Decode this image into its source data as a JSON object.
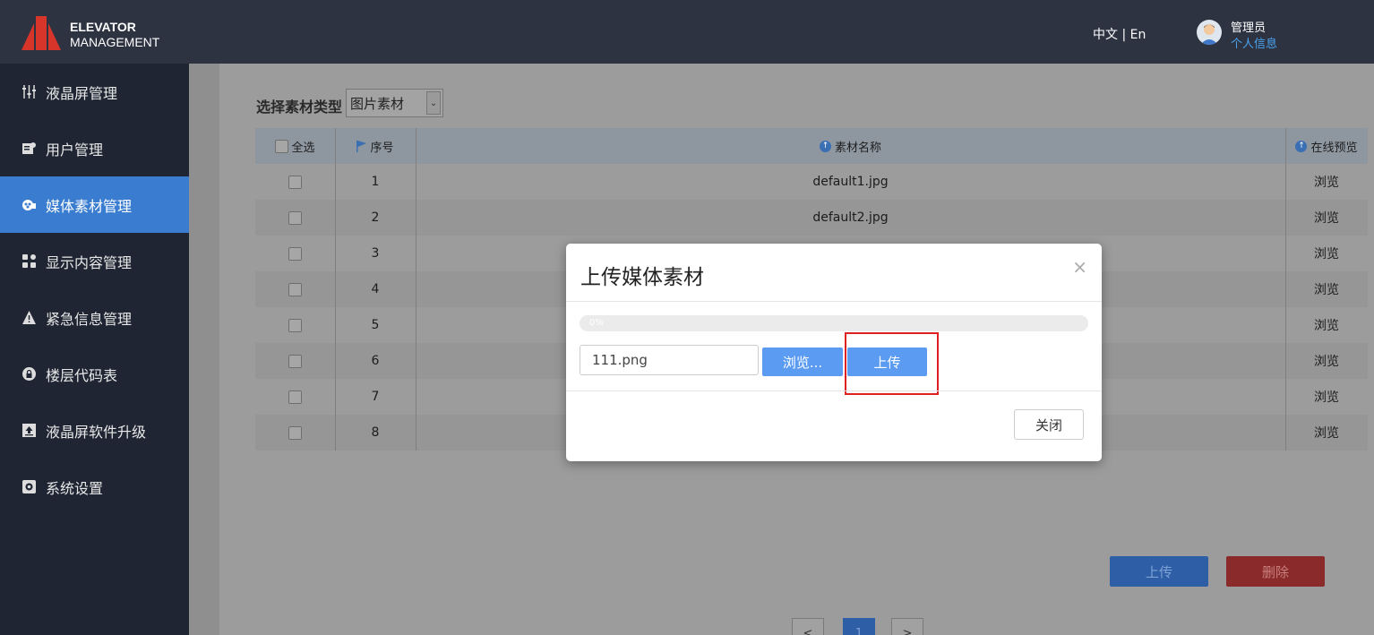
{
  "header": {
    "brand_line1": "ELEVATOR",
    "brand_line2": "MANAGEMENT",
    "language": "中文 | En",
    "user_role": "管理员",
    "user_link": "个人信息"
  },
  "sidebar": {
    "items": [
      {
        "label": "液晶屏管理",
        "icon": "sliders-icon"
      },
      {
        "label": "用户管理",
        "icon": "user-card-icon"
      },
      {
        "label": "媒体素材管理",
        "icon": "media-icon",
        "active": true
      },
      {
        "label": "显示内容管理",
        "icon": "grid-icon"
      },
      {
        "label": "紧急信息管理",
        "icon": "warning-icon"
      },
      {
        "label": "楼层代码表",
        "icon": "lock-icon"
      },
      {
        "label": "液晶屏软件升级",
        "icon": "upload-icon"
      },
      {
        "label": "系统设置",
        "icon": "gear-icon"
      }
    ]
  },
  "filter": {
    "label": "选择素材类型",
    "selected": "图片素材"
  },
  "table": {
    "headers": {
      "select_all": "全选",
      "index": "序号",
      "name": "素材名称",
      "preview": "在线预览"
    },
    "rows": [
      {
        "index": "1",
        "name": "default1.jpg",
        "preview": "浏览"
      },
      {
        "index": "2",
        "name": "default2.jpg",
        "preview": "浏览"
      },
      {
        "index": "3",
        "name": "",
        "preview": "浏览"
      },
      {
        "index": "4",
        "name": "",
        "preview": "浏览"
      },
      {
        "index": "5",
        "name": "",
        "preview": "浏览"
      },
      {
        "index": "6",
        "name": "",
        "preview": "浏览"
      },
      {
        "index": "7",
        "name": "",
        "preview": "浏览"
      },
      {
        "index": "8",
        "name": "",
        "preview": "浏览"
      }
    ]
  },
  "actions": {
    "upload": "上传",
    "delete": "删除"
  },
  "pagination": {
    "prev": "<",
    "current": "1",
    "next": ">"
  },
  "modal": {
    "title": "上传媒体素材",
    "close_symbol": "×",
    "progress_percent": 0,
    "progress_text": "0%",
    "file_name": "111.png",
    "browse_label": "浏览...",
    "upload_label": "上传",
    "close_label": "关闭"
  },
  "colors": {
    "accent": "#3a7dd0",
    "topbar": "#2d3341",
    "sidebar": "#1f2533",
    "modal_button": "#5b9cf2",
    "highlight": "#e02020"
  }
}
